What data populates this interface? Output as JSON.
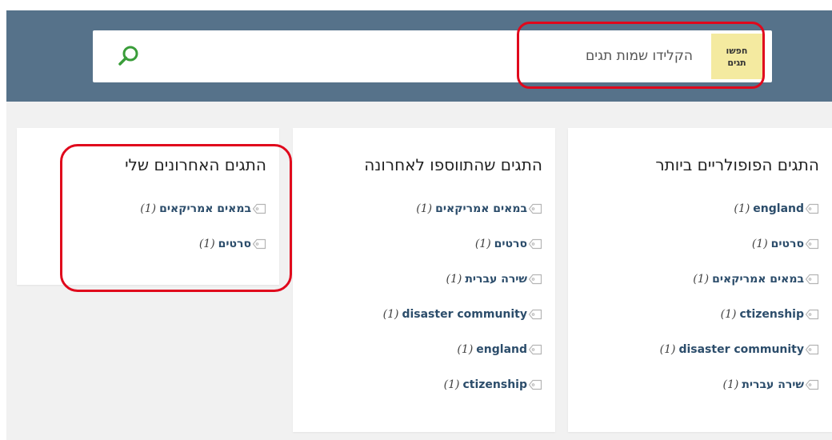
{
  "search": {
    "label_line1": "חפשו",
    "label_line2": "תגים",
    "placeholder": "הקלידו שמות תגים",
    "value": "",
    "button_icon": "search-icon"
  },
  "colors": {
    "header": "#56728a",
    "background": "#f1f1f1",
    "search_label_bg": "#f4eaa0",
    "tag_link": "#2c4d6b",
    "search_icon": "#3a9d3a",
    "highlight": "#e0081c"
  },
  "columns": {
    "popular": {
      "title": "התגים הפופולריים ביותר",
      "tags": [
        {
          "name": "england",
          "count": "(1)"
        },
        {
          "name": "סרטים",
          "count": "(1)"
        },
        {
          "name": "במאים אמריקאים",
          "count": "(1)"
        },
        {
          "name": "ctizenship",
          "count": "(1)"
        },
        {
          "name": "disaster community",
          "count": "(1)"
        },
        {
          "name": "שירה עברית",
          "count": "(1)"
        }
      ]
    },
    "latest": {
      "title": "התגים שהתווספו לאחרונה",
      "tags": [
        {
          "name": "במאים אמריקאים",
          "count": "(1)"
        },
        {
          "name": "סרטים",
          "count": "(1)"
        },
        {
          "name": "שירה עברית",
          "count": "(1)"
        },
        {
          "name": "disaster community",
          "count": "(1)"
        },
        {
          "name": "england",
          "count": "(1)"
        },
        {
          "name": "ctizenship",
          "count": "(1)"
        }
      ]
    },
    "mine": {
      "title": "התגים האחרונים שלי",
      "tags": [
        {
          "name": "במאים אמריקאים",
          "count": "(1)"
        },
        {
          "name": "סרטים",
          "count": "(1)"
        }
      ]
    }
  }
}
